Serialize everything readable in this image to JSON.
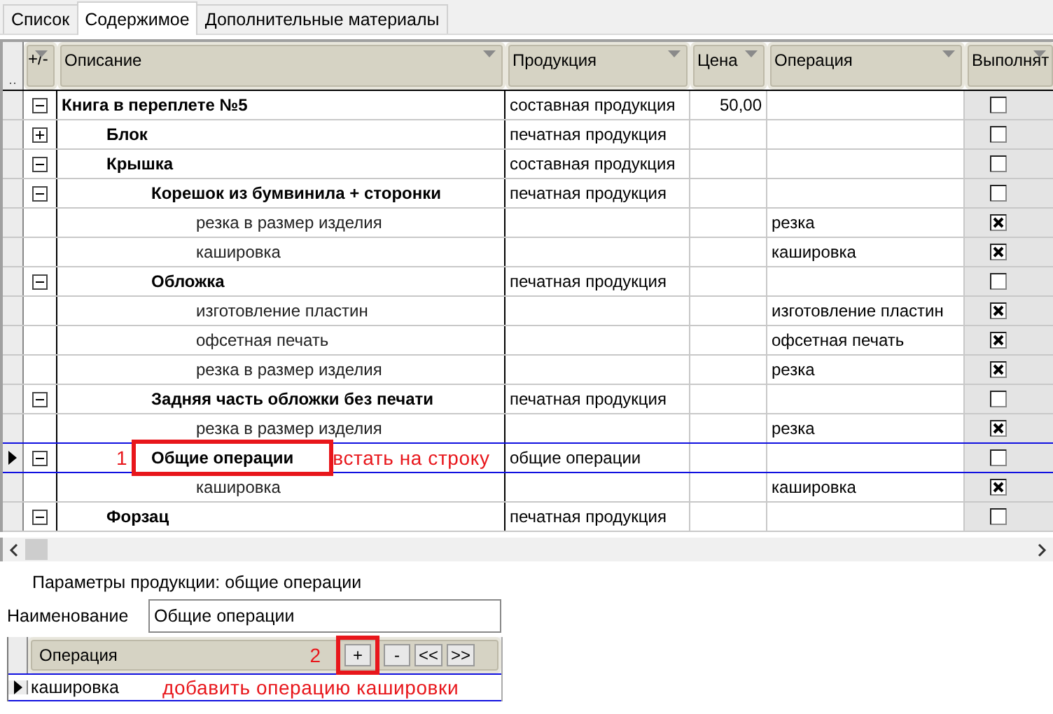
{
  "tabs": [
    {
      "label": "Список",
      "selected": false
    },
    {
      "label": "Содержимое",
      "selected": true
    },
    {
      "label": "Дополнительные материалы",
      "selected": false
    }
  ],
  "table": {
    "columns": [
      "+/-",
      "Описание",
      "Продукция",
      "Цена",
      "Операция",
      "Выполнят"
    ],
    "rows": [
      {
        "kind": "product",
        "name": "Книга в переплете №5",
        "product": "составная продукция",
        "price": "50,00",
        "execute": false,
        "expanded": true,
        "selected": false,
        "children": [
          {
            "kind": "product",
            "name": "Блок",
            "product": "печатная продукция",
            "execute": false,
            "expanded": false,
            "selected": false
          },
          {
            "kind": "product",
            "name": "Крышка",
            "product": "составная продукция",
            "execute": false,
            "expanded": true,
            "selected": false,
            "children": [
              {
                "kind": "product",
                "name": "Корешок из бумвинила + сторонки",
                "product": "печатная продукция",
                "execute": false,
                "expanded": true,
                "selected": false,
                "children": [
                  {
                    "kind": "operation",
                    "name": "резка в размер изделия",
                    "operation": "резка",
                    "execute": true,
                    "selected": false
                  },
                  {
                    "kind": "operation",
                    "name": "кашировка",
                    "operation": "кашировка",
                    "execute": true,
                    "selected": false
                  }
                ]
              },
              {
                "kind": "product",
                "name": "Обложка",
                "product": "печатная продукция",
                "execute": false,
                "expanded": true,
                "selected": false,
                "children": [
                  {
                    "kind": "operation",
                    "name": "изготовление пластин",
                    "operation": "изготовление пластин",
                    "execute": true,
                    "selected": false
                  },
                  {
                    "kind": "operation",
                    "name": "офсетная печать",
                    "operation": "офсетная печать",
                    "execute": true,
                    "selected": false
                  },
                  {
                    "kind": "operation",
                    "name": "резка в размер изделия",
                    "operation": "резка",
                    "execute": true,
                    "selected": false
                  }
                ]
              },
              {
                "kind": "product",
                "name": "Задняя часть обложки без печати",
                "product": "печатная продукция",
                "execute": false,
                "expanded": true,
                "selected": false,
                "children": [
                  {
                    "kind": "operation",
                    "name": "резка в размер изделия",
                    "operation": "резка",
                    "execute": true,
                    "selected": false
                  }
                ]
              },
              {
                "kind": "product",
                "name": "Общие операции",
                "product": "общие операции",
                "execute": false,
                "expanded": true,
                "selected": true,
                "callout": {
                  "number": "1",
                  "note": "встать на строку"
                },
                "children": [
                  {
                    "kind": "operation",
                    "name": "кашировка",
                    "operation": "кашировка",
                    "execute": true,
                    "selected": false
                  }
                ]
              }
            ]
          },
          {
            "kind": "product",
            "name": "Форзац",
            "product": "печатная продукция",
            "execute": false,
            "expanded": true,
            "selected": false
          }
        ]
      }
    ]
  },
  "params": {
    "title": "Параметры продукции: общие операции",
    "name_label": "Наименование",
    "name_value": "Общие операции"
  },
  "operations_grid": {
    "column": "Операция",
    "buttons": [
      "+",
      "-",
      "<<",
      ">>"
    ],
    "callout": {
      "number": "2",
      "note": "добавить операцию кашировки"
    },
    "rows": [
      {
        "operation": "кашировка",
        "selected": true
      }
    ]
  }
}
